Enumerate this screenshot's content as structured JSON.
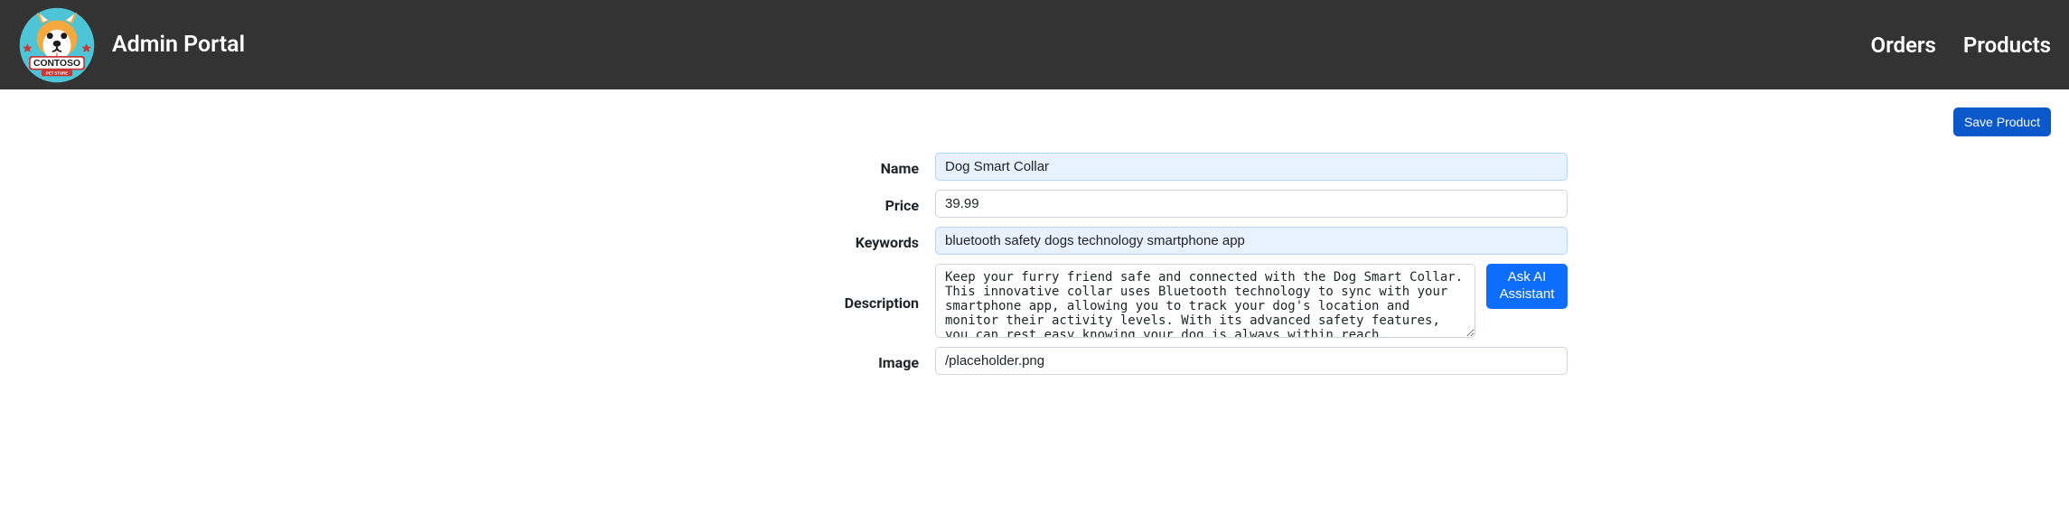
{
  "header": {
    "title": "Admin Portal",
    "nav": {
      "orders": "Orders",
      "products": "Products"
    }
  },
  "actions": {
    "save": "Save Product",
    "askAI": "Ask AI Assistant"
  },
  "labels": {
    "name": "Name",
    "price": "Price",
    "keywords": "Keywords",
    "description": "Description",
    "image": "Image"
  },
  "form": {
    "name": "Dog Smart Collar",
    "price": "39.99",
    "keywords": "bluetooth safety dogs technology smartphone app",
    "description": "Keep your furry friend safe and connected with the Dog Smart Collar. This innovative collar uses Bluetooth technology to sync with your smartphone app, allowing you to track your dog's location and monitor their activity levels. With its advanced safety features, you can rest easy knowing your dog is always within reach.",
    "image": "/placeholder.png"
  }
}
